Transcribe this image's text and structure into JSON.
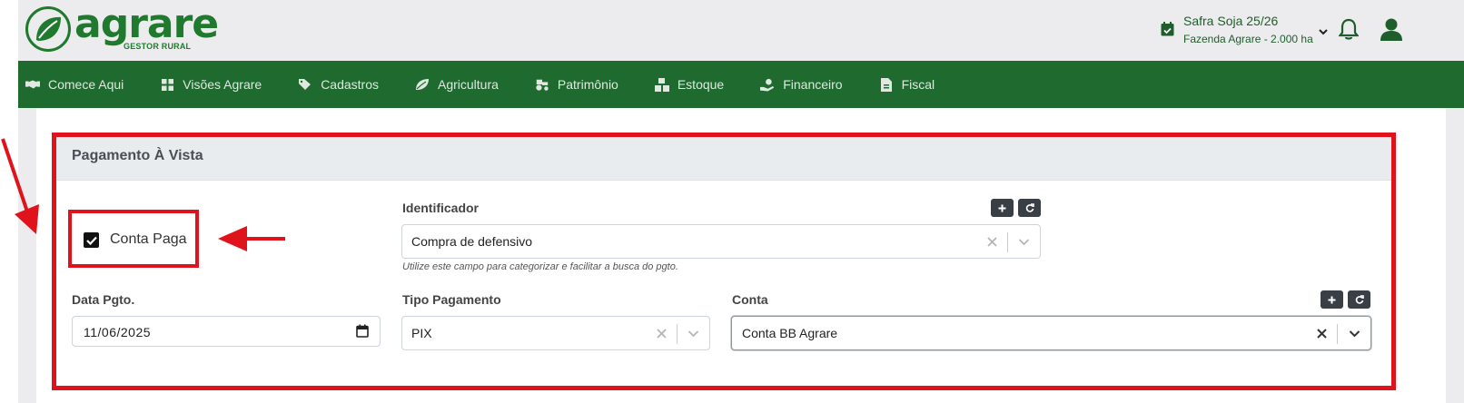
{
  "header": {
    "logo_name": "agrare",
    "logo_sub": "GESTOR RURAL",
    "safra_title": "Safra Soja 25/26",
    "safra_sub": "Fazenda Agrare - 2.000 ha"
  },
  "nav": {
    "items": [
      {
        "label": "Comece Aqui",
        "icon": "handshake-icon"
      },
      {
        "label": "Visões Agrare",
        "icon": "dashboard-grid-icon"
      },
      {
        "label": "Cadastros",
        "icon": "tags-icon"
      },
      {
        "label": "Agricultura",
        "icon": "leaf-icon"
      },
      {
        "label": "Patrimônio",
        "icon": "tractor-icon"
      },
      {
        "label": "Estoque",
        "icon": "boxes-icon"
      },
      {
        "label": "Financeiro",
        "icon": "hand-dollar-icon"
      },
      {
        "label": "Fiscal",
        "icon": "invoice-icon"
      }
    ]
  },
  "card": {
    "title": "Pagamento À Vista",
    "conta_paga": {
      "label": "Conta Paga",
      "checked": true
    },
    "identificador": {
      "label": "Identificador",
      "value": "Compra de defensivo",
      "hint": "Utilize este campo para categorizar e facilitar a busca do pgto."
    },
    "data_pgto": {
      "label": "Data Pgto.",
      "value": "11/06/2025"
    },
    "tipo_pagamento": {
      "label": "Tipo Pagamento",
      "value": "PIX"
    },
    "conta": {
      "label": "Conta",
      "value": "Conta BB Agrare"
    }
  },
  "colors": {
    "brand_green": "#1f7a2e",
    "nav_green": "#1e6a2f",
    "highlight_red": "#e0121b",
    "button_dark": "#3a3f45"
  }
}
